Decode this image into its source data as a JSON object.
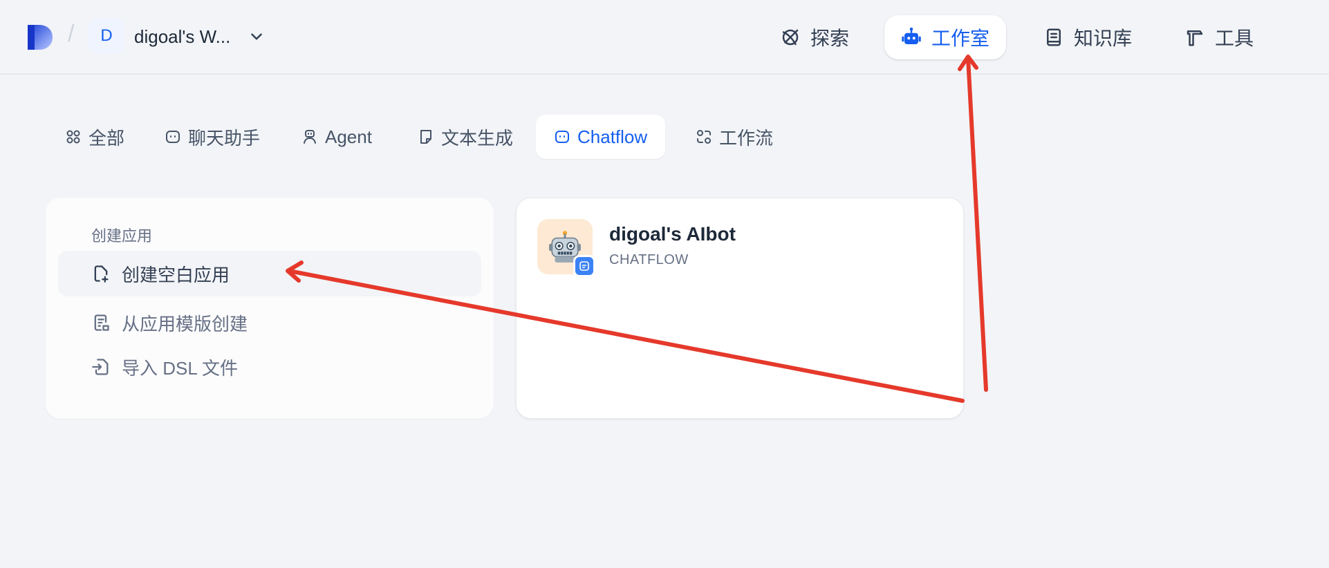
{
  "header": {
    "workspace_initial": "D",
    "workspace_name": "digoal's W...",
    "nav": [
      {
        "label": "探索",
        "icon": "compass-icon"
      },
      {
        "label": "工作室",
        "icon": "robot-icon",
        "active": true
      },
      {
        "label": "知识库",
        "icon": "book-icon"
      },
      {
        "label": "工具",
        "icon": "hammer-icon"
      }
    ]
  },
  "tabs": [
    {
      "label": "全部",
      "icon": "grid-icon"
    },
    {
      "label": "聊天助手",
      "icon": "chat-bot-icon"
    },
    {
      "label": "Agent",
      "icon": "agent-icon"
    },
    {
      "label": "文本生成",
      "icon": "document-icon"
    },
    {
      "label": "Chatflow",
      "icon": "chat-bot-icon",
      "active": true
    },
    {
      "label": "工作流",
      "icon": "workflow-icon"
    }
  ],
  "create_card": {
    "title": "创建应用",
    "items": [
      {
        "label": "创建空白应用",
        "icon": "file-plus-icon"
      },
      {
        "label": "从应用模版创建",
        "icon": "template-icon"
      },
      {
        "label": "导入 DSL 文件",
        "icon": "file-import-icon"
      }
    ]
  },
  "app_card": {
    "name": "digoal's AIbot",
    "type": "CHATFLOW",
    "icon": "robot-emoji-icon",
    "badge_icon": "chat-badge-icon"
  },
  "colors": {
    "accent": "#155eef",
    "background": "#f2f4f7",
    "annotation": "#e5392b",
    "app_icon_bg": "#fde9d4"
  }
}
